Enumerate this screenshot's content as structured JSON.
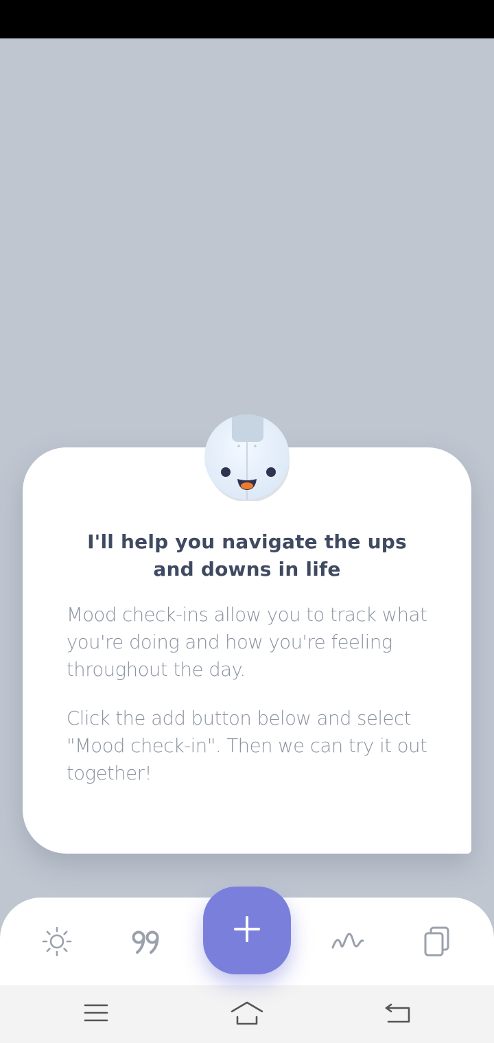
{
  "onboarding": {
    "title": "I'll help you navigate the ups and downs in life",
    "paragraph_1": "Mood check-ins allow you to track what you're doing and how you're feeling throughout the day.",
    "paragraph_2": "Click the add button below and select \"Mood check-in\". Then we can try it out together!"
  },
  "bottom_nav": {
    "items": [
      {
        "icon": "sun-icon"
      },
      {
        "icon": "quote-icon"
      },
      {
        "icon": "plus-icon"
      },
      {
        "icon": "wave-icon"
      },
      {
        "icon": "copy-icon"
      }
    ]
  },
  "system_nav": {
    "items": [
      {
        "icon": "menu-icon"
      },
      {
        "icon": "home-icon"
      },
      {
        "icon": "back-icon"
      }
    ]
  },
  "colors": {
    "overlay": "#bfc6d0",
    "accent": "#7b7fdc",
    "title_text": "#3f4a61",
    "body_text": "#8b93a0",
    "nav_icon": "#9aa1ac"
  }
}
